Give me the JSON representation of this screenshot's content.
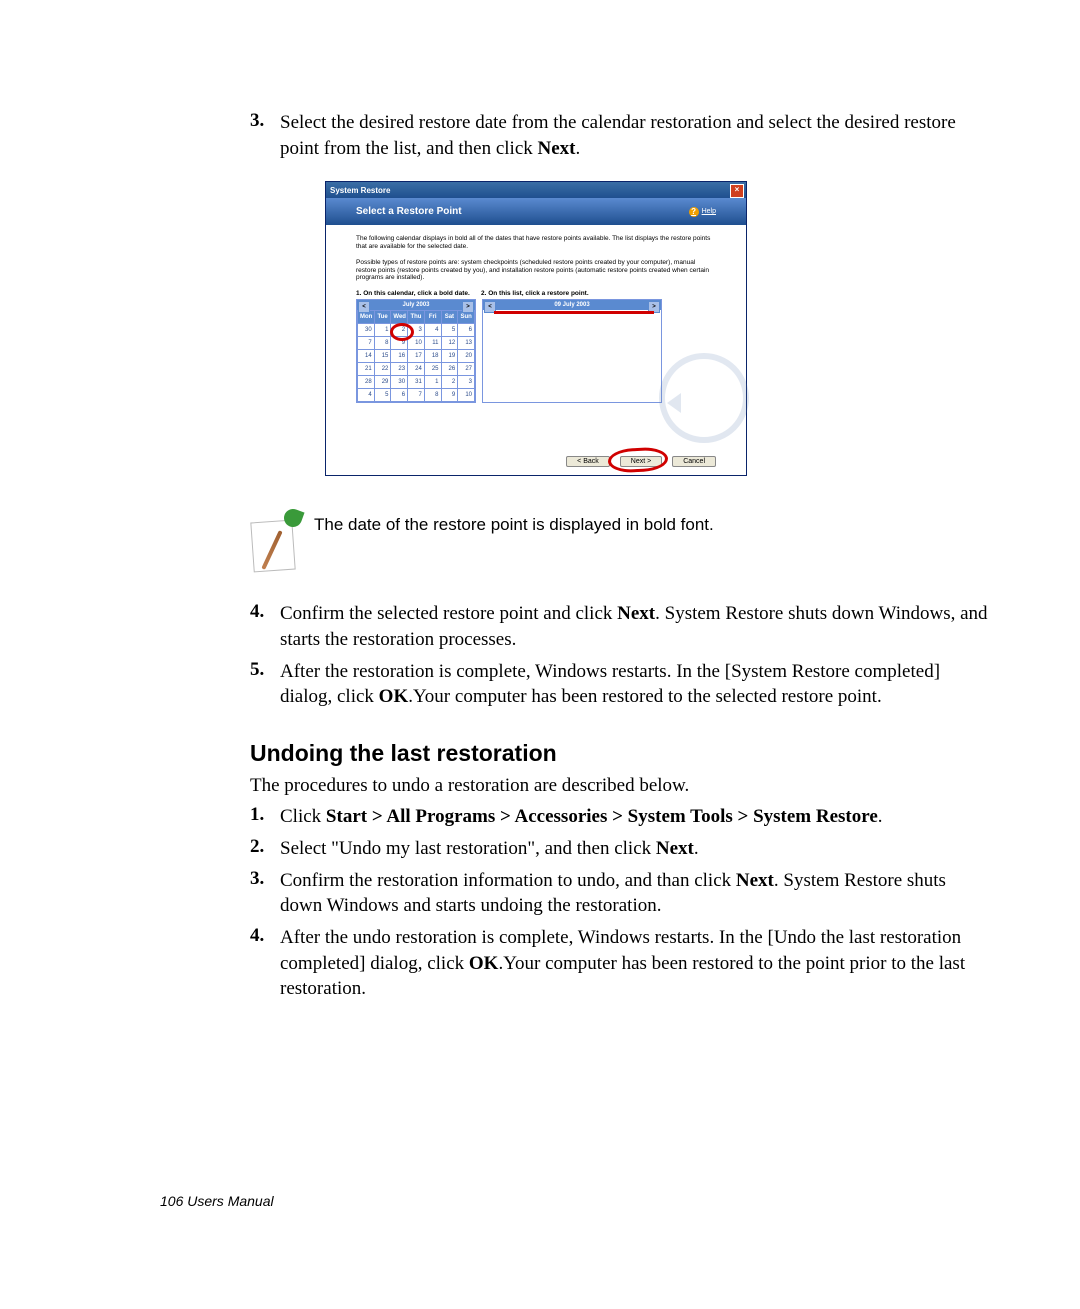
{
  "steps_a": [
    {
      "num": "3.",
      "parts": [
        {
          "t": "Select the desired restore date from the calendar restoration and select the desired restore point from the list, and then click "
        },
        {
          "t": "Next",
          "b": true
        },
        {
          "t": "."
        }
      ]
    }
  ],
  "screenshot": {
    "title": "System Restore",
    "header_title": "Select a Restore Point",
    "help_label": "Help",
    "p1": "The following calendar displays in bold all of the dates that have restore points available. The list displays the restore points that are available for the selected date.",
    "p2": "Possible types of restore points are: system checkpoints (scheduled restore points created by your computer), manual restore points (restore points created by you), and installation restore points (automatic restore points created when certain programs are installed).",
    "label1": "1. On this calendar, click a bold date.",
    "label2": "2. On this list, click a restore point.",
    "cal_month": "July 2003",
    "cal_days": [
      "Mon",
      "Tue",
      "Wed",
      "Thu",
      "Fri",
      "Sat",
      "Sun"
    ],
    "cal_rows": [
      [
        "30",
        "1",
        "2",
        "3",
        "4",
        "5",
        "6"
      ],
      [
        "7",
        "8",
        "9",
        "10",
        "11",
        "12",
        "13"
      ],
      [
        "14",
        "15",
        "16",
        "17",
        "18",
        "19",
        "20"
      ],
      [
        "21",
        "22",
        "23",
        "24",
        "25",
        "26",
        "27"
      ],
      [
        "28",
        "29",
        "30",
        "31",
        "1",
        "2",
        "3"
      ],
      [
        "4",
        "5",
        "6",
        "7",
        "8",
        "9",
        "10"
      ]
    ],
    "list_date": "09 July 2003",
    "btn_back": "< Back",
    "btn_next": "Next >",
    "btn_cancel": "Cancel"
  },
  "note": "The date of the restore point is displayed in bold font.",
  "steps_b": [
    {
      "num": "4.",
      "parts": [
        {
          "t": "Confirm the selected restore point and click "
        },
        {
          "t": "Next",
          "b": true
        },
        {
          "t": ". System Restore shuts down Windows, and starts the restoration processes."
        }
      ]
    },
    {
      "num": "5.",
      "parts": [
        {
          "t": "After the restoration is complete, Windows restarts. In the [System Restore completed] dialog, click "
        },
        {
          "t": "OK",
          "b": true
        },
        {
          "t": ".Your computer has been restored to the selected restore point."
        }
      ]
    }
  ],
  "section2_title": "Undoing the last restoration",
  "section2_intro": "The procedures to undo a restoration are described below.",
  "steps_c": [
    {
      "num": "1.",
      "parts": [
        {
          "t": "Click "
        },
        {
          "t": "Start > All Programs > Accessories > System Tools > System Restore",
          "b": true
        },
        {
          "t": "."
        }
      ]
    },
    {
      "num": "2.",
      "parts": [
        {
          "t": "Select \"Undo my last restoration\", and then click "
        },
        {
          "t": "Next",
          "b": true
        },
        {
          "t": "."
        }
      ]
    },
    {
      "num": "3.",
      "parts": [
        {
          "t": "Confirm the restoration information to undo, and than click "
        },
        {
          "t": "Next",
          "b": true
        },
        {
          "t": ". System Restore shuts down Windows and starts undoing the restoration."
        }
      ]
    },
    {
      "num": "4.",
      "parts": [
        {
          "t": "After the undo restoration is complete, Windows restarts. In the [Undo the last restoration completed] dialog, click "
        },
        {
          "t": "OK",
          "b": true
        },
        {
          "t": ".Your computer has been restored to the point prior to the last restoration."
        }
      ]
    }
  ],
  "footer": "106  Users Manual"
}
